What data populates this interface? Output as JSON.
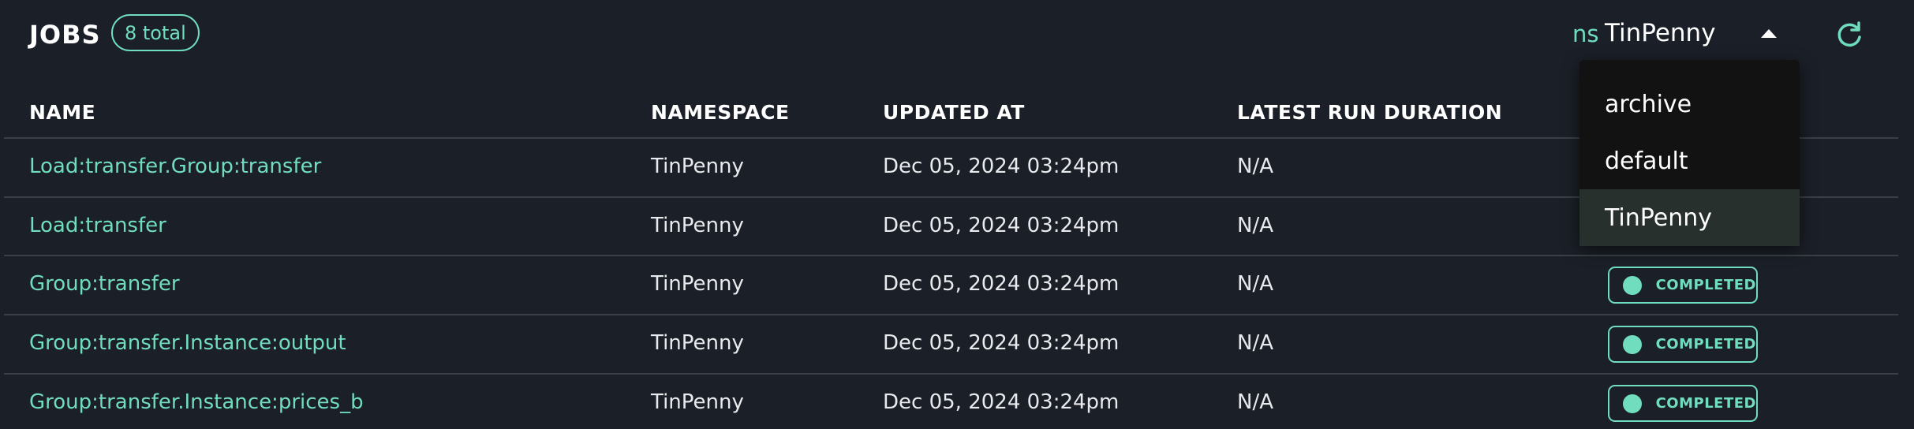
{
  "header": {
    "title": "JOBS",
    "count_badge": "8 total",
    "namespace_prefix": "ns",
    "namespace_selected": "TinPenny",
    "refresh_icon": "refresh-icon"
  },
  "table": {
    "columns": [
      "NAME",
      "NAMESPACE",
      "UPDATED AT",
      "LATEST RUN DURATION"
    ],
    "rows": [
      {
        "name": "Load:transfer.Group:transfer",
        "namespace": "TinPenny",
        "updated_at": "Dec 05, 2024 03:24pm",
        "duration": "N/A",
        "status": ""
      },
      {
        "name": "Load:transfer",
        "namespace": "TinPenny",
        "updated_at": "Dec 05, 2024 03:24pm",
        "duration": "N/A",
        "status": ""
      },
      {
        "name": "Group:transfer",
        "namespace": "TinPenny",
        "updated_at": "Dec 05, 2024 03:24pm",
        "duration": "N/A",
        "status": "COMPLETED"
      },
      {
        "name": "Group:transfer.Instance:output",
        "namespace": "TinPenny",
        "updated_at": "Dec 05, 2024 03:24pm",
        "duration": "N/A",
        "status": "COMPLETED"
      },
      {
        "name": "Group:transfer.Instance:prices_b",
        "namespace": "TinPenny",
        "updated_at": "Dec 05, 2024 03:24pm",
        "duration": "N/A",
        "status": "COMPLETED"
      }
    ]
  },
  "namespace_menu": {
    "options": [
      "archive",
      "default",
      "TinPenny"
    ],
    "selected_index": 2
  },
  "colors": {
    "background": "#1b1f27",
    "accent": "#71ddbf",
    "divider": "#3b4048",
    "menu_background": "#121212",
    "menu_selected": "#27302d"
  }
}
